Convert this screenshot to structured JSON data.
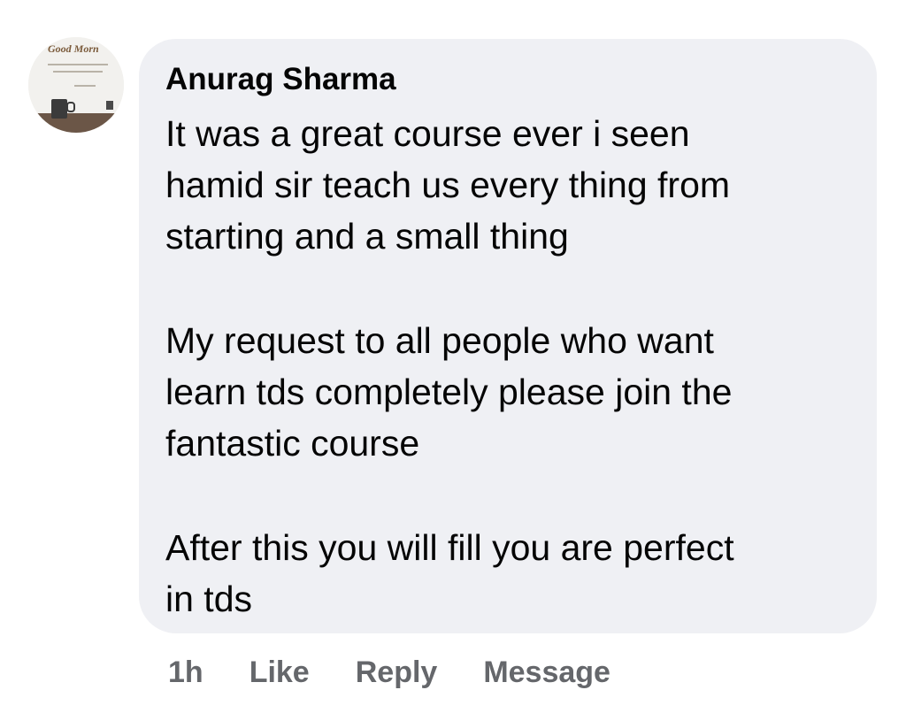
{
  "comment": {
    "author": "Anurag Sharma",
    "paragraphs": [
      "It was a great course ever i seen\nhamid sir teach us every thing from\nstarting and a small thing",
      "My request to all people who want\nlearn tds completely please join the\nfantastic course",
      "After this you will fill you are perfect\nin tds"
    ],
    "time": "1h",
    "actions": {
      "like": "Like",
      "reply": "Reply",
      "message": "Message"
    }
  },
  "avatar": {
    "overlay_text": "Good Morn"
  },
  "colors": {
    "bubble_bg": "#eff0f4",
    "text": "#050505",
    "secondary_text": "#65676b"
  }
}
